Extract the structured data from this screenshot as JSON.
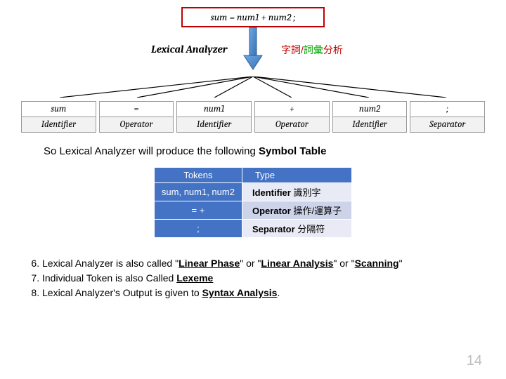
{
  "diagram": {
    "source_code": "sum = num1 + num2 ;",
    "analyzer_label": "Lexical Analyzer",
    "cn_prefix": "字詞/",
    "cn_green": "詞彙",
    "cn_suffix": "分析"
  },
  "tokens": [
    {
      "value": "sum",
      "type": "Identifier"
    },
    {
      "value": "=",
      "type": "Operator"
    },
    {
      "value": "num1",
      "type": "Identifier"
    },
    {
      "value": "+",
      "type": "Operator"
    },
    {
      "value": "num2",
      "type": "Identifier"
    },
    {
      "value": ";",
      "type": "Separator"
    }
  ],
  "intro": {
    "prefix": "So Lexical Analyzer will produce the following ",
    "bold": "Symbol Table"
  },
  "table": {
    "headers": {
      "col1": "Tokens",
      "col2": "Type"
    },
    "rows": [
      {
        "tokens": "sum, num1, num2",
        "type_bold": "Identifier",
        "type_rest": " 識別字"
      },
      {
        "tokens": "= +",
        "type_bold": "Operator",
        "type_rest": " 操作/運算子"
      },
      {
        "tokens": ";",
        "type_bold": "Separator",
        "type_rest": " 分隔符"
      }
    ]
  },
  "notes": {
    "start": 6,
    "n6_a": "Lexical Analyzer is also called \"",
    "n6_u1": "Linear Phase",
    "n6_b": "\" or \"",
    "n6_u2": "Linear Analysis",
    "n6_c": "\" or \"",
    "n6_u3": "Scanning",
    "n6_d": "\"",
    "n7_a": "Individual Token is also Called ",
    "n7_u": "Lexeme",
    "n8_a": "Lexical Analyzer's Output is given to ",
    "n8_u": "Syntax Analysis",
    "n8_b": "."
  },
  "page_number": "14"
}
